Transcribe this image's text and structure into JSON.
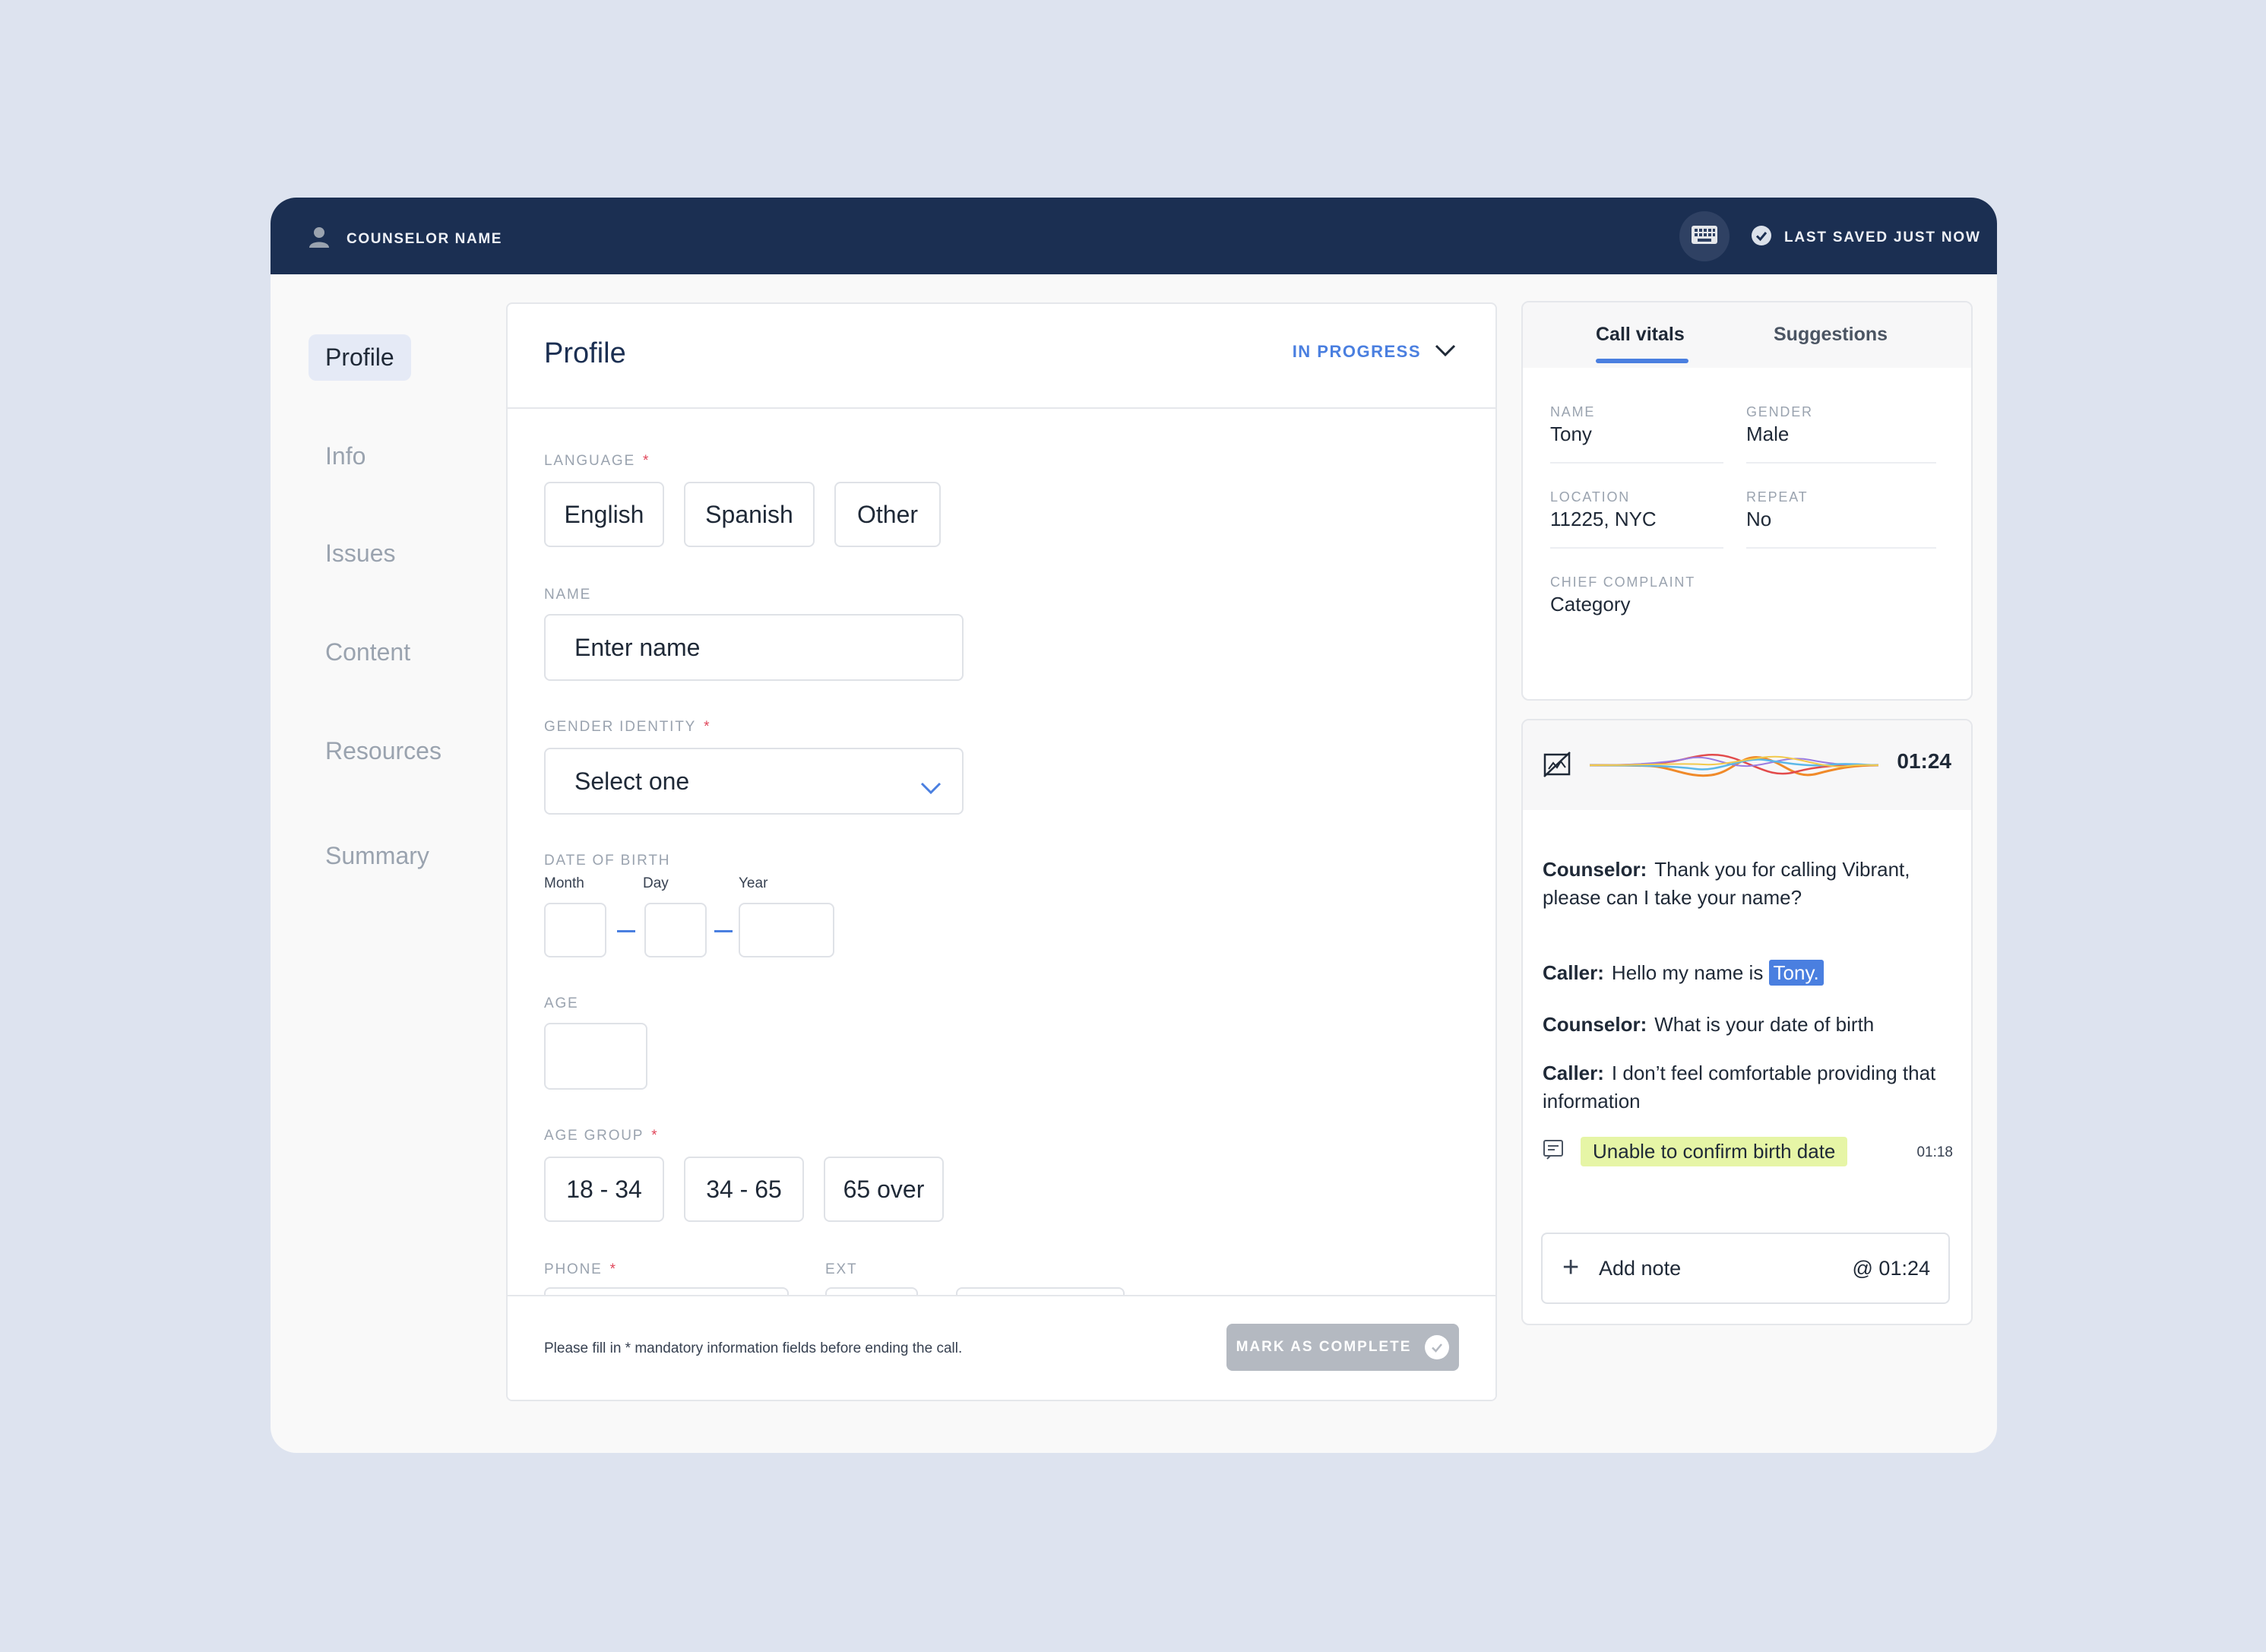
{
  "header": {
    "counselor_label": "COUNSELOR NAME",
    "last_saved": "LAST SAVED JUST NOW"
  },
  "nav": {
    "items": [
      {
        "label": "Profile",
        "active": true
      },
      {
        "label": "Info"
      },
      {
        "label": "Issues"
      },
      {
        "label": "Content"
      },
      {
        "label": "Resources"
      },
      {
        "label": "Summary"
      }
    ]
  },
  "profile": {
    "title": "Profile",
    "status": "IN PROGRESS",
    "language": {
      "label": "LANGUAGE",
      "options": [
        "English",
        "Spanish",
        "Other"
      ]
    },
    "name": {
      "label": "NAME",
      "placeholder": "Enter name"
    },
    "gender": {
      "label": "GENDER IDENTITY",
      "placeholder": "Select one"
    },
    "dob": {
      "label": "DATE OF BIRTH",
      "month": "Month",
      "day": "Day",
      "year": "Year"
    },
    "age": {
      "label": "AGE"
    },
    "age_group": {
      "label": "AGE GROUP",
      "options": [
        "18 - 34",
        "34 - 65",
        "65 over"
      ]
    },
    "phone": {
      "label": "PHONE",
      "ext_label": "EXT"
    },
    "required_mark": "*",
    "footer_note": "Please fill in * mandatory information fields before ending the call.",
    "complete_label": "MARK AS COMPLETE"
  },
  "vitals": {
    "tabs": [
      "Call vitals",
      "Suggestions"
    ],
    "fields": {
      "name": {
        "label": "NAME",
        "value": "Tony"
      },
      "gender": {
        "label": "GENDER",
        "value": "Male"
      },
      "location": {
        "label": "LOCATION",
        "value": "11225, NYC"
      },
      "repeat": {
        "label": "REPEAT",
        "value": "No"
      },
      "complaint": {
        "label": "CHIEF COMPLAINT",
        "value": "Category"
      }
    }
  },
  "transcript": {
    "timer": "01:24",
    "messages": [
      {
        "speaker": "Counselor:",
        "text": "Thank you for calling Vibrant, please can I take your name?"
      },
      {
        "speaker": "Caller:",
        "text": "Hello my name is ",
        "highlight": "Tony."
      },
      {
        "speaker": "Counselor:",
        "text": "What is your date of birth"
      },
      {
        "speaker": "Caller:",
        "text": "I don’t feel comfortable providing that information"
      }
    ],
    "flag_note": "Unable to confirm birth date",
    "flag_time": "01:18",
    "add_note_label": "Add note",
    "add_note_time": "@ 01:24"
  },
  "colors": {
    "topbar": "#1b2f52",
    "accent": "#4a7fe0",
    "required": "#e0475b",
    "flag_highlight": "#e6f5a6"
  },
  "icons": [
    "user-icon",
    "keyboard-icon",
    "check-circle-icon",
    "chevron-down-icon",
    "waveform-icon",
    "no-video-icon",
    "note-icon",
    "plus-icon"
  ]
}
